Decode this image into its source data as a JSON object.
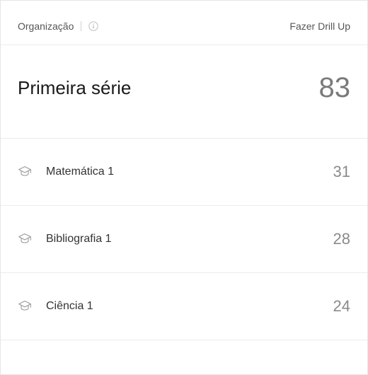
{
  "header": {
    "label": "Organização",
    "drill_up": "Fazer Drill Up"
  },
  "summary": {
    "title": "Primeira série",
    "value": "83"
  },
  "items": [
    {
      "label": "Matemática 1",
      "value": "31"
    },
    {
      "label": "Bibliografia 1",
      "value": "28"
    },
    {
      "label": "Ciência 1",
      "value": "24"
    }
  ]
}
